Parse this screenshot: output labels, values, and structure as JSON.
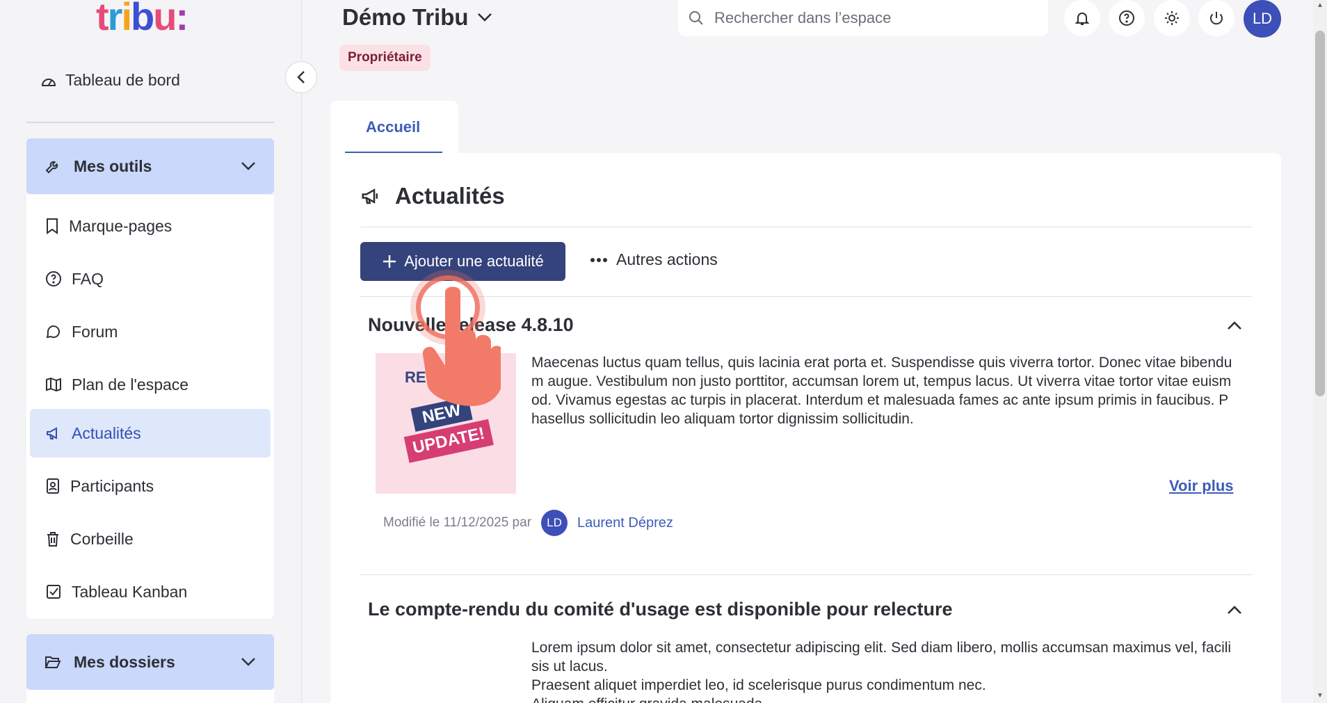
{
  "sidebar": {
    "logo": {
      "t": "t",
      "r": "r",
      "i": "i",
      "b": "b",
      "u": "u",
      "colon": ":"
    },
    "dashboard_label": "Tableau de bord",
    "tools_group": {
      "label": "Mes outils",
      "icon": "wrench-icon"
    },
    "items": [
      {
        "label": "Marque-pages",
        "icon": "bookmark-icon",
        "active": false
      },
      {
        "label": "FAQ",
        "icon": "help-circle-icon",
        "active": false
      },
      {
        "label": "Forum",
        "icon": "chat-icon",
        "active": false
      },
      {
        "label": "Plan de l'espace",
        "icon": "map-icon",
        "active": false
      },
      {
        "label": "Actualités",
        "icon": "megaphone-icon",
        "active": true
      },
      {
        "label": "Participants",
        "icon": "contacts-icon",
        "active": false
      },
      {
        "label": "Corbeille",
        "icon": "trash-icon",
        "active": false
      },
      {
        "label": "Tableau Kanban",
        "icon": "checkbox-icon",
        "active": false
      }
    ],
    "folders_group": {
      "label": "Mes dossiers",
      "icon": "folder-open-icon"
    }
  },
  "header": {
    "space_title": "Démo Tribu",
    "role_badge": "Propriétaire",
    "search_placeholder": "Rechercher dans l’espace",
    "user_initials": "LD"
  },
  "tabs": [
    {
      "label": "Accueil",
      "selected": true
    }
  ],
  "section": {
    "title": "Actualités",
    "add_button": "Ajouter une actualité",
    "more_actions": "Autres actions"
  },
  "news": [
    {
      "title": "Nouvelle release 4.8.10",
      "image_text": {
        "top": "REL",
        "new": "NEW",
        "update": "UPDATE!"
      },
      "body": "Maecenas luctus quam tellus, quis lacinia erat porta et. Suspendisse quis viverra tortor. Donec vitae bibendum augue. Vestibulum non justo porttitor, accumsan lorem ut, tempus lacus. Ut viverra vitae tortor vitae euismod. Vivamus egestas ac turpis in placerat. Interdum et malesuada fames ac ante ipsum primis in faucibus. Phasellus sollicitudin leo aliquam tortor dignissim sollicitudin.",
      "see_more": "Voir plus",
      "modified": "Modifié le 11/12/2025 par",
      "author_initials": "LD",
      "author": "Laurent Déprez"
    },
    {
      "title": "Le compte-rendu du comité d'usage est disponible pour relecture",
      "body_lines": [
        "Lorem ipsum dolor sit amet, consectetur adipiscing elit. Sed diam libero, mollis accumsan maximus vel, facilisis ut lacus.",
        "Praesent aliquet imperdiet leo, id scelerisque purus condimentum nec.",
        "Aliquam efficitur gravida malesuada."
      ]
    }
  ],
  "colors": {
    "accent": "#34437c",
    "active_bg": "#dfe7fb",
    "group_bg": "#c9d8fb",
    "badge_bg": "#fbe1e6"
  }
}
